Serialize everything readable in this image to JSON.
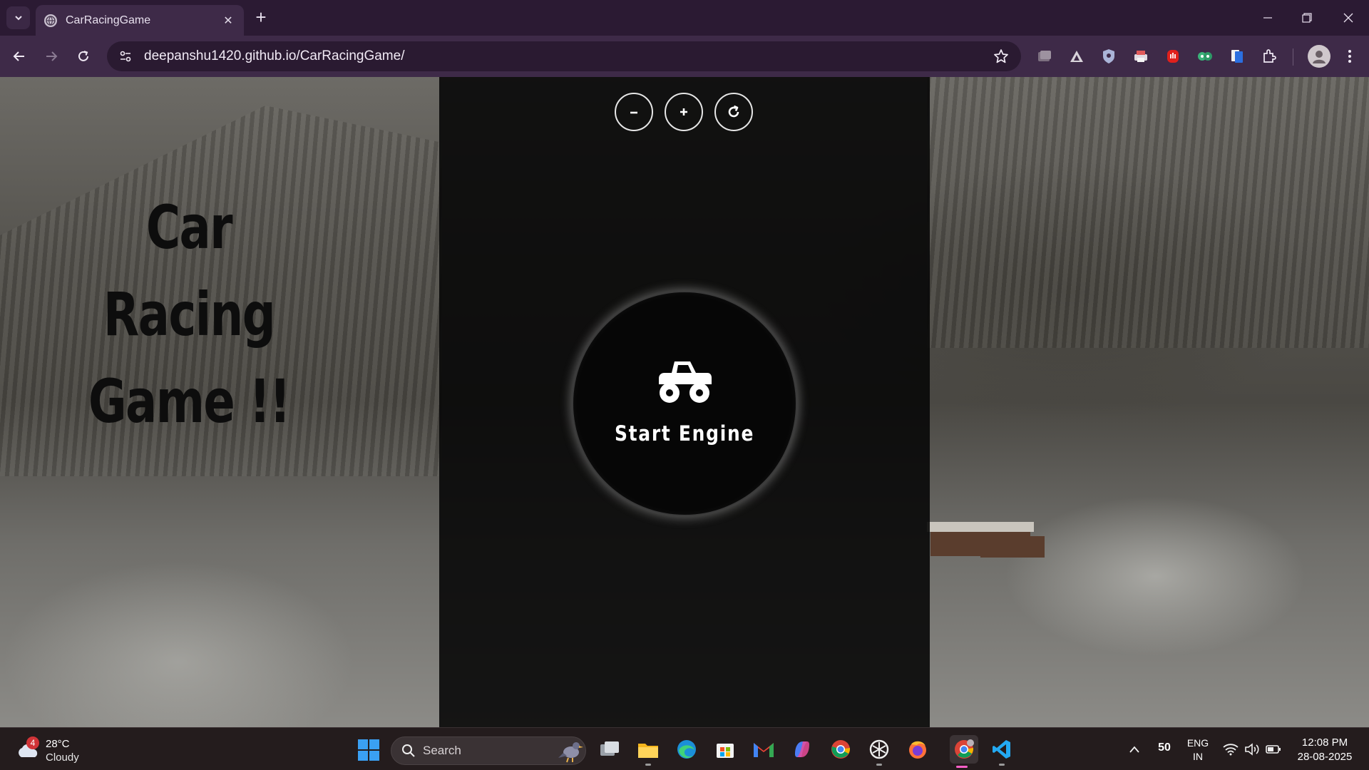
{
  "browser": {
    "tab_title": "CarRacingGame",
    "url": "deepanshu1420.github.io/CarRacingGame/"
  },
  "page": {
    "title_line1": "Car Racing",
    "title_line2": "Game !!"
  },
  "game": {
    "controls": [
      {
        "symbol": "−",
        "name": "decrease"
      },
      {
        "symbol": "+",
        "name": "increase"
      },
      {
        "symbol": "↻",
        "name": "restart"
      }
    ],
    "start_label": "Start Engine"
  },
  "taskbar": {
    "weather_badge": "4",
    "temperature": "28°C",
    "condition": "Cloudy",
    "search_label": "Search",
    "tray_number": "50",
    "language_line1": "ENG",
    "language_line2": "IN",
    "time": "12:08 PM",
    "date": "28-08-2025"
  },
  "colors": {
    "chrome_titlebar": "#2b1a33",
    "chrome_toolbar": "#3e2a48",
    "game_panel": "#080808",
    "taskbar": "#241c1d"
  }
}
